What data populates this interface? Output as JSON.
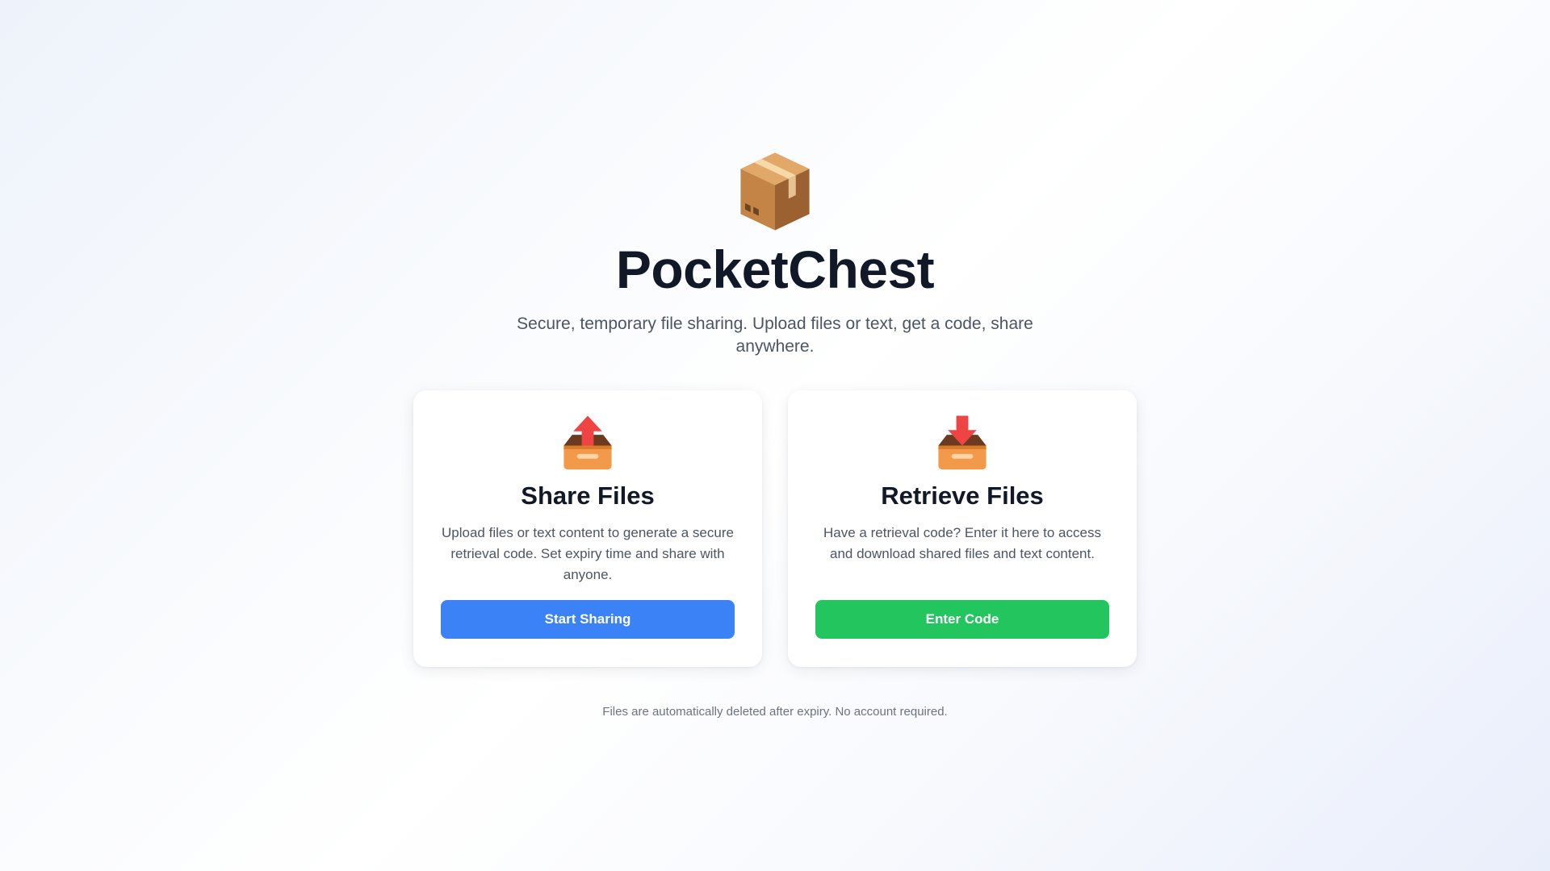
{
  "app": {
    "title": "PocketChest",
    "tagline": "Secure, temporary file sharing. Upload files or text, get a code, share anywhere.",
    "logo_icon": "package-box-icon"
  },
  "cards": [
    {
      "icon": "outbox-tray-icon",
      "title": "Share Files",
      "description": "Upload files or text content to generate a secure retrieval code. Set expiry time and share with anyone.",
      "button_label": "Start Sharing",
      "button_color": "#3b82f6"
    },
    {
      "icon": "inbox-tray-icon",
      "title": "Retrieve Files",
      "description": "Have a retrieval code? Enter it here to access and download shared files and text content.",
      "button_label": "Enter Code",
      "button_color": "#22c55e"
    }
  ],
  "footer": {
    "note": "Files are automatically deleted after expiry. No account required."
  },
  "colors": {
    "title": "#111827",
    "body_text": "#4b5563",
    "muted_text": "#6b7280",
    "primary": "#3b82f6",
    "success": "#22c55e"
  }
}
